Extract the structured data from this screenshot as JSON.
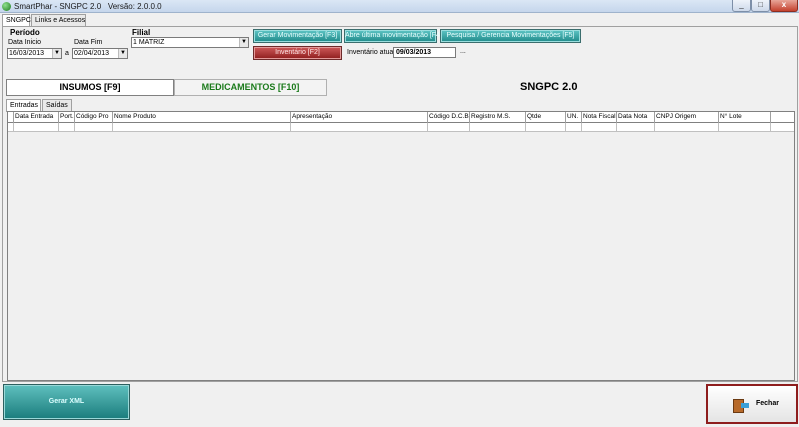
{
  "window": {
    "title": "SmartPhar - SNGPC 2.0",
    "version": "Versão: 2.0.0.0",
    "min_label": "_",
    "max_label": "□",
    "close_label": "x"
  },
  "tabs": [
    {
      "label": "SNGPC"
    },
    {
      "label": "Links e Acessos"
    }
  ],
  "periodo": {
    "title": "Período",
    "data_inicio_label": "Data Inicio",
    "data_inicio_value": "16/03/2013",
    "separator": "a",
    "data_fim_label": "Data Fim",
    "data_fim_value": "02/04/2013"
  },
  "filial": {
    "label": "Filial",
    "value": "1 MATRIZ"
  },
  "actions": {
    "gerar_movimentacao": "Gerar Movimentação [F3]",
    "abre_ultima": "Abre última movimentação [F4]",
    "pesquisa": "Pesquisa / Gerencia Movimentações [F5]",
    "inventario": "Inventário [F2]",
    "inventario_atual_label": "Inventário atual:",
    "inventario_atual_value": "09/03/2013",
    "ellipsis": "..."
  },
  "toggles": {
    "insumos": "INSUMOS [F9]",
    "medicamentos": "MEDICAMENTOS [F10]"
  },
  "heading": "SNGPC 2.0",
  "subtabs": [
    {
      "label": "Entradas"
    },
    {
      "label": "Saídas"
    }
  ],
  "grid": {
    "columns": [
      "Data Entrada",
      "Port.",
      "Código Pro",
      "Nome Produto",
      "Apresentação",
      "Código D.C.B.",
      "Registro M.S.",
      "Qtde",
      "UN.",
      "Nota Fiscal",
      "Data Nota",
      "CNPJ Origem",
      "N° Lote"
    ]
  },
  "footer": {
    "gerar_xml": "Gerar XML",
    "fechar": "Fechar"
  },
  "colors": {
    "green_button": "#1f8a8a",
    "red_button": "#8e1d1d",
    "medicamentos_text": "#1a7a1a"
  }
}
